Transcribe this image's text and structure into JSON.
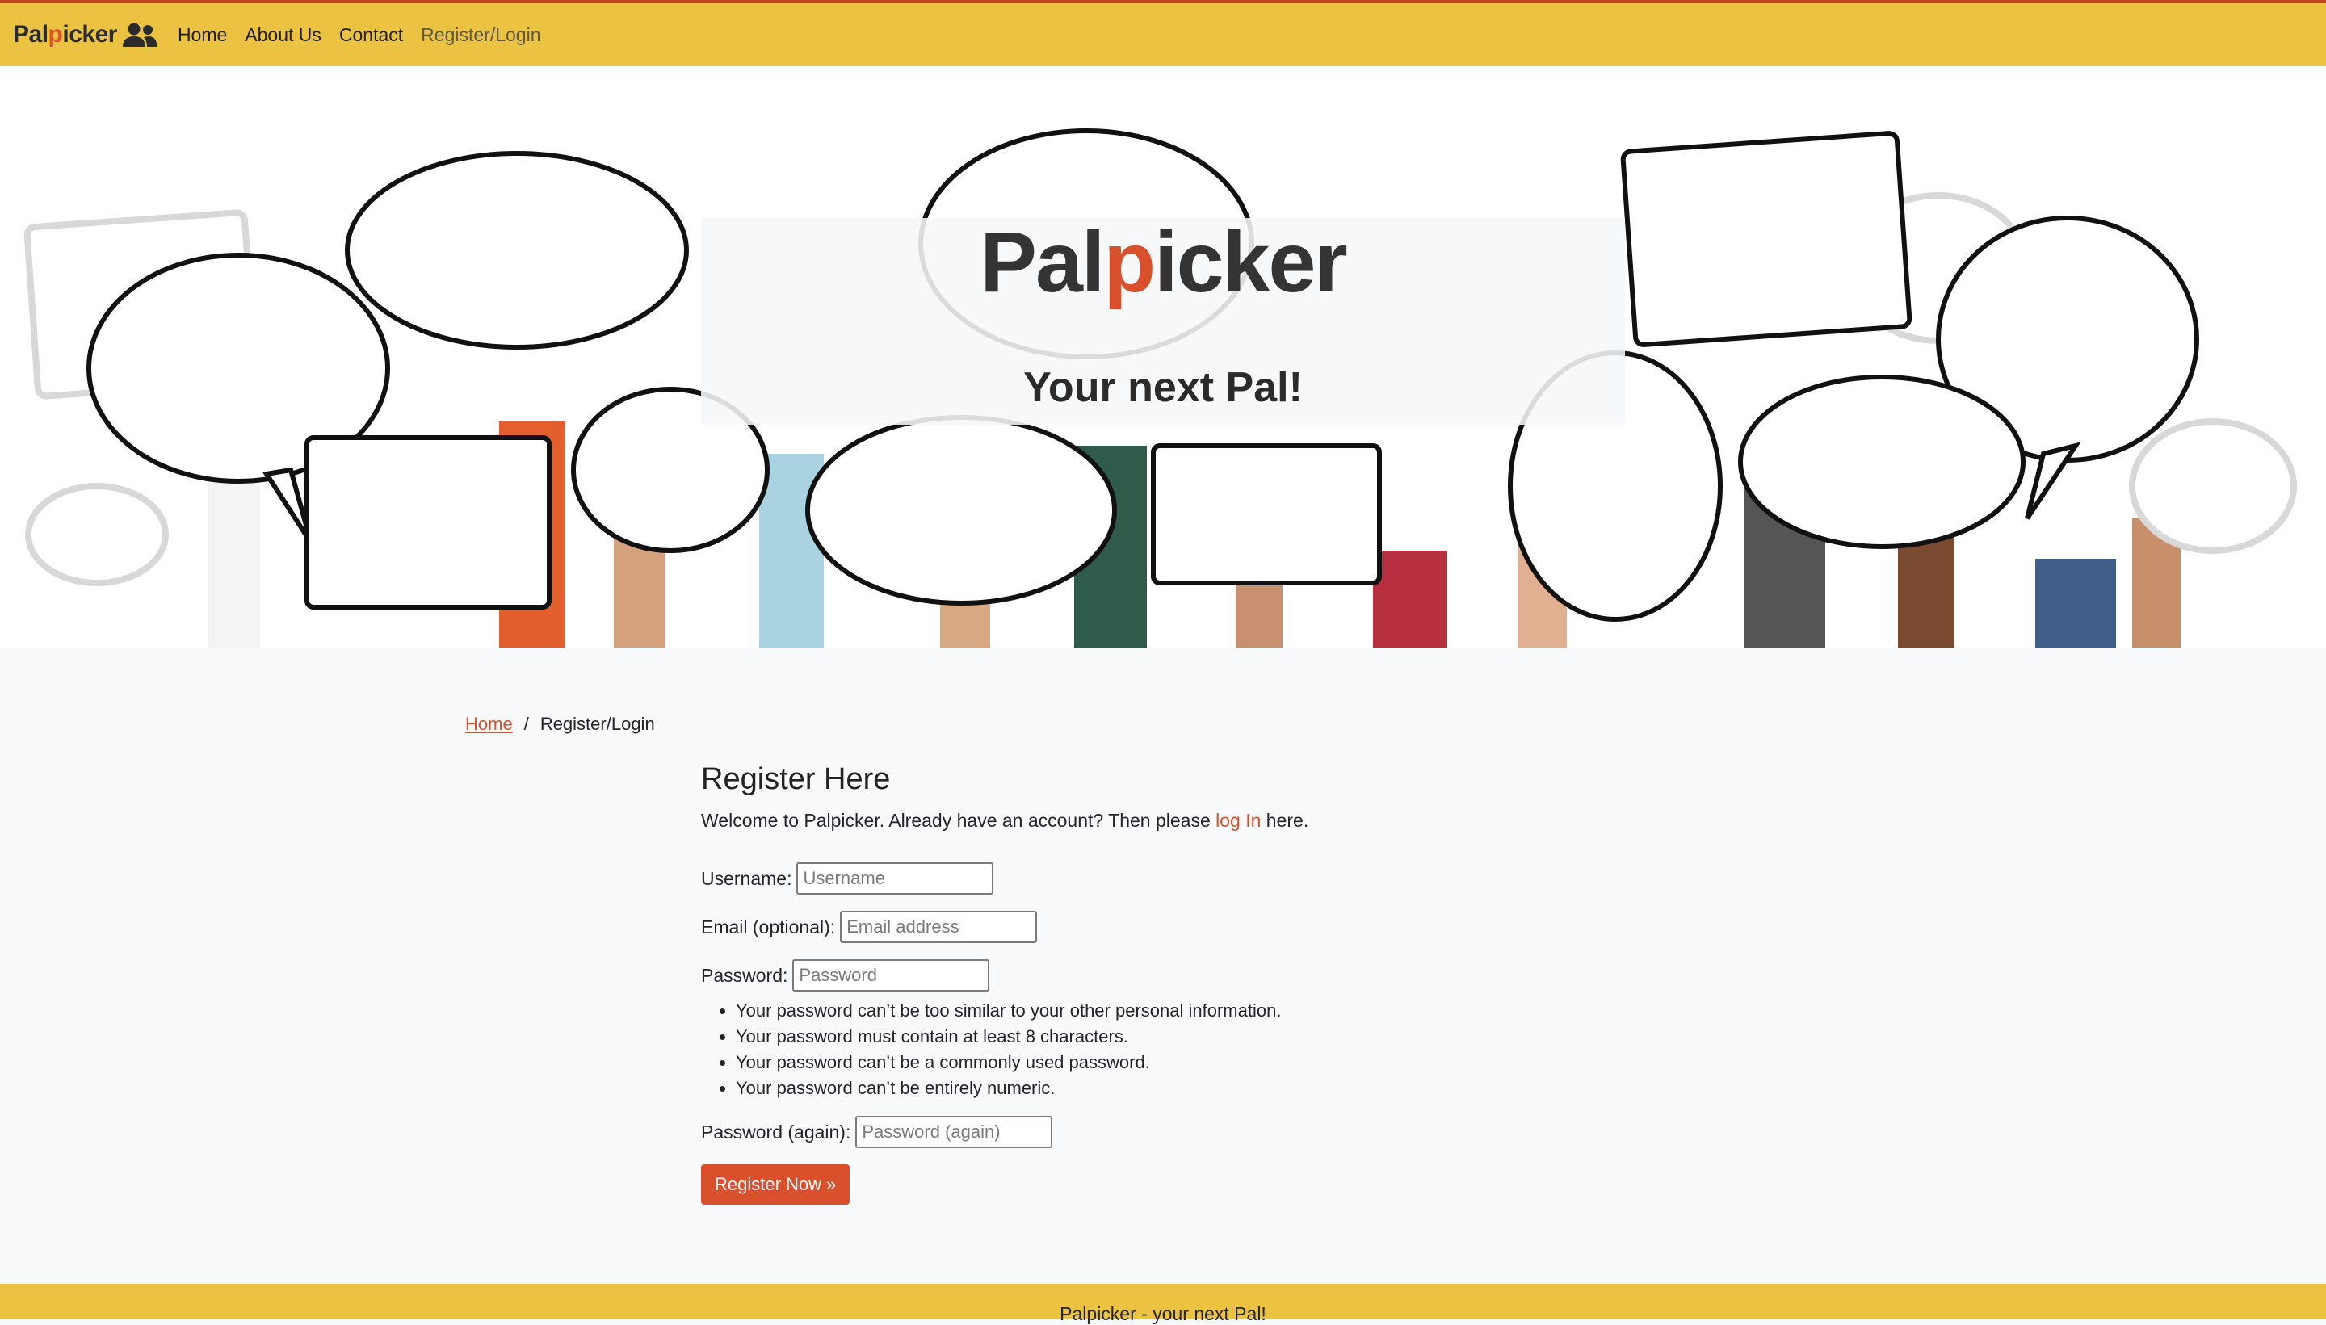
{
  "brand": {
    "name_part1": "Pal",
    "name_accent": "p",
    "name_part2": "icker"
  },
  "nav": {
    "items": [
      {
        "label": "Home"
      },
      {
        "label": "About Us"
      },
      {
        "label": "Contact"
      },
      {
        "label": "Register/Login"
      }
    ]
  },
  "hero": {
    "title_part1": "Pal",
    "title_accent": "p",
    "title_part2": "icker",
    "subtitle": "Your next Pal!"
  },
  "breadcrumb": {
    "home": "Home",
    "separator": "/",
    "current": "Register/Login"
  },
  "register": {
    "title": "Register Here",
    "welcome_before": "Welcome to Palpicker. Already have an account? Then please ",
    "login_link": "log In",
    "welcome_after": " here.",
    "username_label": "Username:",
    "username_placeholder": "Username",
    "email_label": "Email (optional):",
    "email_placeholder": "Email address",
    "password_label": "Password:",
    "password_placeholder": "Password",
    "password_rules": [
      "Your password can’t be too similar to your other personal information.",
      "Your password must contain at least 8 characters.",
      "Your password can’t be a commonly used password.",
      "Your password can’t be entirely numeric."
    ],
    "password2_label": "Password (again):",
    "password2_placeholder": "Password (again)",
    "submit_label": "Register Now »"
  },
  "footer": {
    "text": "Palpicker - your next Pal!"
  },
  "colors": {
    "accent": "#d9502c",
    "brand_yellow": "#ecc242",
    "top_border": "#c8402a"
  }
}
